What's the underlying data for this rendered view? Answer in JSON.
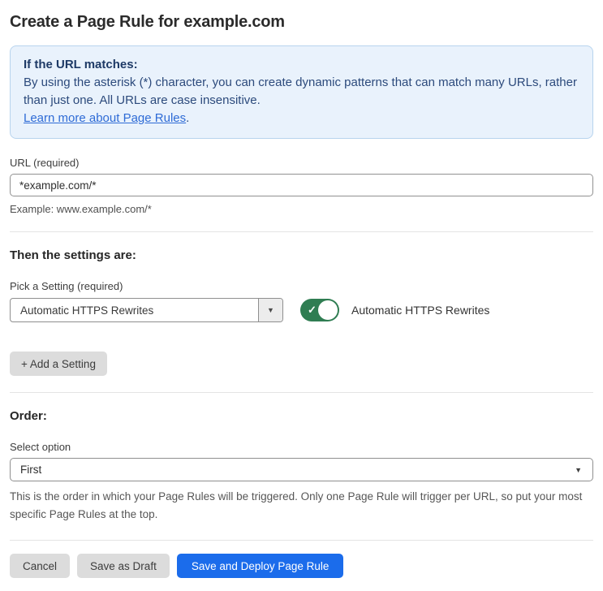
{
  "page": {
    "title": "Create a Page Rule for example.com"
  },
  "info_box": {
    "heading": "If the URL matches:",
    "body": "By using the asterisk (*) character, you can create dynamic patterns that can match many URLs, rather than just one. All URLs are case insensitive.",
    "link_label": "Learn more about Page Rules",
    "link_suffix": "."
  },
  "url_field": {
    "label": "URL (required)",
    "value": "*example.com/*",
    "example": "Example: www.example.com/*"
  },
  "settings_section": {
    "heading": "Then the settings are:",
    "pick_label": "Pick a Setting (required)",
    "selected_setting": "Automatic HTTPS Rewrites",
    "dropdown_arrow": "▼",
    "toggle_on": true,
    "toggle_check": "✓",
    "toggle_label": "Automatic HTTPS Rewrites",
    "add_setting_label": "+ Add a Setting"
  },
  "order_section": {
    "heading": "Order:",
    "select_label": "Select option",
    "selected_option": "First",
    "select_caret": "▼",
    "help_text": "This is the order in which your Page Rules will be triggered. Only one Page Rule will trigger per URL, so put your most specific Page Rules at the top."
  },
  "footer": {
    "cancel_label": "Cancel",
    "save_draft_label": "Save as Draft",
    "save_deploy_label": "Save and Deploy Page Rule"
  },
  "colors": {
    "accent_blue": "#1b6ceb",
    "toggle_green": "#2f7d52",
    "info_bg": "#e9f2fc",
    "info_border": "#b8d4ee",
    "info_text": "#2c4a7c",
    "link_blue": "#2e6bd6"
  }
}
